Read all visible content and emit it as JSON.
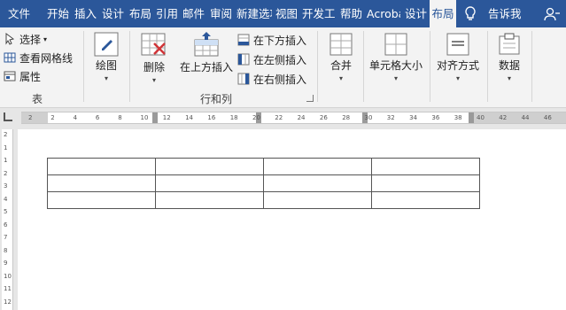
{
  "tabs": [
    {
      "label": "文件"
    },
    {
      "label": "开始"
    },
    {
      "label": "插入"
    },
    {
      "label": "设计"
    },
    {
      "label": "布局"
    },
    {
      "label": "引用"
    },
    {
      "label": "邮件"
    },
    {
      "label": "审阅"
    },
    {
      "label": "新建选项"
    },
    {
      "label": "视图"
    },
    {
      "label": "开发工"
    },
    {
      "label": "帮助"
    },
    {
      "label": "Acrobat"
    },
    {
      "label": "设计"
    },
    {
      "label": "布局"
    }
  ],
  "tell_me": "告诉我",
  "ribbon": {
    "table_group": {
      "select": "选择",
      "view_gridlines": "查看网格线",
      "properties": "属性",
      "label": "表"
    },
    "draw": "绘图",
    "delete": "删除",
    "insert_above": "在上方插入",
    "insert_below": "在下方插入",
    "insert_left": "在左侧插入",
    "insert_right": "在右侧插入",
    "rows_cols_label": "行和列",
    "merge": "合并",
    "cell_size": "单元格大小",
    "alignment": "对齐方式",
    "data": "数据"
  },
  "ruler": {
    "numbers": [
      "2",
      "2",
      "4",
      "6",
      "8",
      "10",
      "12",
      "14",
      "16",
      "18",
      "20",
      "22",
      "24",
      "26",
      "28",
      "30",
      "32",
      "34",
      "36",
      "38",
      "40",
      "42",
      "44",
      "46"
    ]
  },
  "vruler": {
    "numbers": [
      "2",
      "1",
      "1",
      "2",
      "3",
      "4",
      "5",
      "6",
      "7",
      "8",
      "9",
      "10",
      "11",
      "12"
    ]
  },
  "document": {
    "table": {
      "rows": 3,
      "cols": 4
    }
  },
  "colors": {
    "accent": "#2b579a",
    "ribbon": "#f3f3f3",
    "active_tab_text": "#2b579a"
  }
}
